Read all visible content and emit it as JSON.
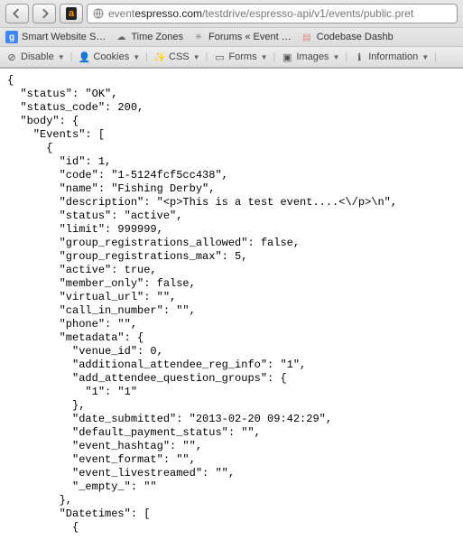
{
  "nav": {
    "url_prefix": "event",
    "url_host": "espresso.com",
    "url_path": "/testdrive/espresso-api/v1/events/public.pret"
  },
  "bookmarks": [
    {
      "label": "Smart Website S…",
      "icon": "g"
    },
    {
      "label": "Time Zones",
      "icon": "cloud"
    },
    {
      "label": "Forums « Event …",
      "icon": "forum"
    },
    {
      "label": "Codebase Dashb",
      "icon": "codebase"
    }
  ],
  "devtools": [
    {
      "label": "Disable",
      "icon": "nosign"
    },
    {
      "label": "Cookies",
      "icon": "person"
    },
    {
      "label": "CSS",
      "icon": "wand"
    },
    {
      "label": "Forms",
      "icon": "form"
    },
    {
      "label": "Images",
      "icon": "image"
    },
    {
      "label": "Information",
      "icon": "info"
    }
  ],
  "json_view": {
    "status": "OK",
    "status_code": 200,
    "event": {
      "id": 1,
      "code": "1-5124fcf5cc438",
      "name": "Fishing Derby",
      "description": "<p>This is a test event....<\\/p>\\n",
      "status": "active",
      "limit": 999999,
      "group_registrations_allowed": false,
      "group_registrations_max": 5,
      "active": true,
      "member_only": false,
      "virtual_url": "",
      "call_in_number": "",
      "phone": "",
      "metadata": {
        "venue_id": 0,
        "additional_attendee_reg_info": "1",
        "add_attendee_question_groups": {
          "1": "1"
        },
        "date_submitted": "2013-02-20 09:42:29",
        "default_payment_status": "",
        "event_hashtag": "",
        "event_format": "",
        "event_livestreamed": "",
        "_empty_": ""
      }
    }
  }
}
